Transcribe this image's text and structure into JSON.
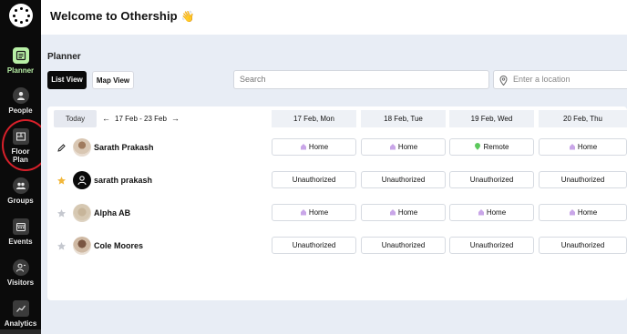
{
  "header": {
    "welcome": "Welcome to Othership",
    "wave": "👋"
  },
  "sidebar": {
    "items": [
      {
        "label": "Planner",
        "icon": "planner-icon",
        "active": true
      },
      {
        "label": "People",
        "icon": "people-icon"
      },
      {
        "label": "Floor\nPlan",
        "icon": "floor-plan-icon"
      },
      {
        "label": "Groups",
        "icon": "groups-icon"
      },
      {
        "label": "Events",
        "icon": "events-icon"
      },
      {
        "label": "Visitors",
        "icon": "visitors-icon"
      },
      {
        "label": "Analytics",
        "icon": "analytics-icon"
      }
    ]
  },
  "main": {
    "title": "Planner",
    "list_view_label": "List View",
    "map_view_label": "Map View",
    "search_placeholder": "Search",
    "location_placeholder": "Enter a location"
  },
  "table": {
    "today_label": "Today",
    "range": "17 Feb - 23 Feb",
    "dates": [
      "17 Feb, Mon",
      "18 Feb, Tue",
      "19 Feb, Wed",
      "20 Feb, Thu"
    ],
    "rows": [
      {
        "name": "Sarath Prakash",
        "icon": "pencil-icon",
        "avatar": "photo",
        "cells": [
          {
            "text": "Home",
            "icon": "home-icon"
          },
          {
            "text": "Home",
            "icon": "home-icon"
          },
          {
            "text": "Remote",
            "icon": "remote-icon"
          },
          {
            "text": "Home",
            "icon": "home-icon"
          }
        ]
      },
      {
        "name": "sarath prakash",
        "icon": "star-filled-icon",
        "avatar": "generic",
        "cells": [
          {
            "text": "Unauthorized"
          },
          {
            "text": "Unauthorized"
          },
          {
            "text": "Unauthorized"
          },
          {
            "text": "Unauthorized"
          }
        ]
      },
      {
        "name": "Alpha AB",
        "icon": "star-icon",
        "avatar": "alpha",
        "cells": [
          {
            "text": "Home",
            "icon": "home-icon"
          },
          {
            "text": "Home",
            "icon": "home-icon"
          },
          {
            "text": "Home",
            "icon": "home-icon"
          },
          {
            "text": "Home",
            "icon": "home-icon"
          }
        ]
      },
      {
        "name": "Cole Moores",
        "icon": "star-icon",
        "avatar": "cole",
        "cells": [
          {
            "text": "Unauthorized"
          },
          {
            "text": "Unauthorized"
          },
          {
            "text": "Unauthorized"
          },
          {
            "text": "Unauthorized"
          }
        ]
      }
    ]
  },
  "colors": {
    "accent": "#b8f0a6",
    "highlight_ring": "#d8202a",
    "home_icon": "#c9a6e8",
    "remote_icon": "#5cc85c",
    "star_filled": "#f2b73a",
    "star_empty": "#c5c8cf"
  }
}
